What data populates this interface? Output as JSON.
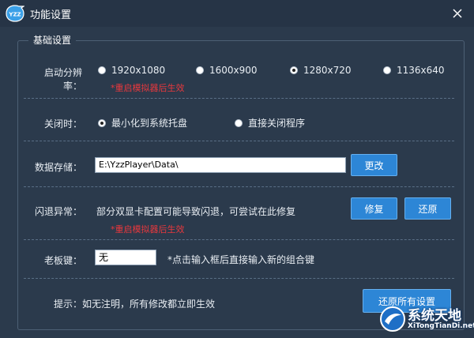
{
  "window": {
    "title": "功能设置",
    "logo_text": "YZZ",
    "close_icon": "close-icon"
  },
  "section": {
    "legend": "基础设置"
  },
  "resolution": {
    "label": "启动分辨率：",
    "options": [
      "1920x1080",
      "1600x900",
      "1280x720",
      "1136x640"
    ],
    "selected": "1280x720",
    "note": "*重启模拟器后生效"
  },
  "close_behavior": {
    "label": "关闭时：",
    "options": [
      "最小化到系统托盘",
      "直接关闭程序"
    ],
    "selected": "最小化到系统托盘"
  },
  "storage": {
    "label": "数据存储：",
    "path": "E:\\YzzPlayer\\Data\\",
    "change_button": "更改"
  },
  "crash": {
    "label": "闪退异常：",
    "description": "部分双显卡配置可能导致闪退，可尝试在此修复",
    "repair_button": "修复",
    "restore_button": "还原",
    "note": "*重启模拟器后生效"
  },
  "boss_key": {
    "label": "老板键：",
    "value": "无",
    "hint": "*点击输入框后直接输入新的组合键"
  },
  "footer": {
    "tip": "提示：如无注明，所有修改都立即生效",
    "reset_button": "还原所有设置"
  },
  "watermark": {
    "name": "系统天地",
    "url": "XiTongTianDi.net"
  },
  "colors": {
    "background": "#2b3a4c",
    "button": "#2d86d6",
    "note_red": "#e8383d"
  }
}
